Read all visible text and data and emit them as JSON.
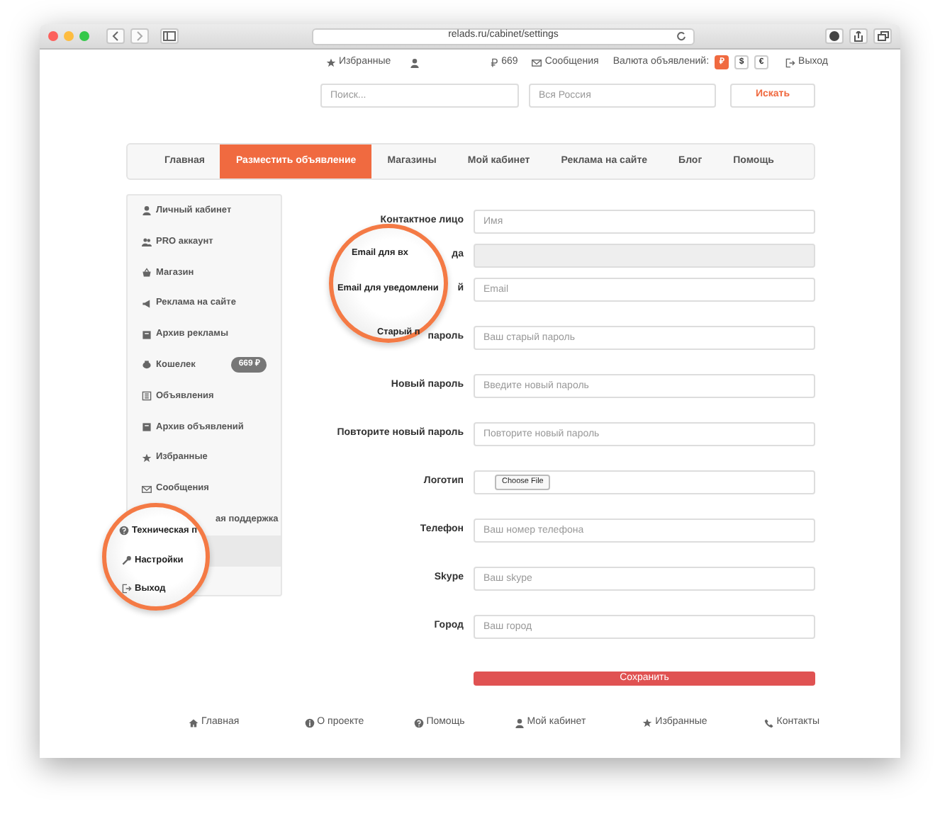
{
  "browser": {
    "url": "relads.ru/cabinet/settings"
  },
  "topbar": {
    "favorites": "Избранные",
    "balance": "669",
    "messages": "Сообщения",
    "currency_label": "Валюта объявлений:",
    "currencies": [
      {
        "label": "₽",
        "selected": true
      },
      {
        "label": "$",
        "selected": false
      },
      {
        "label": "€",
        "selected": false
      }
    ],
    "logout": "Выход"
  },
  "search": {
    "query_placeholder": "Поиск...",
    "region_placeholder": "Вся Россия",
    "button": "Искать"
  },
  "nav": [
    {
      "label": "Главная",
      "selected": false
    },
    {
      "label": "Разместить объявление",
      "selected": true
    },
    {
      "label": "Магазины",
      "selected": false
    },
    {
      "label": "Мой кабинет",
      "selected": false
    },
    {
      "label": "Реклама на сайте",
      "selected": false
    },
    {
      "label": "Блог",
      "selected": false
    },
    {
      "label": "Помощь",
      "selected": false
    }
  ],
  "sidebar": [
    {
      "label": "Личный кабинет",
      "selected": false
    },
    {
      "label": "PRO аккаунт",
      "selected": false
    },
    {
      "label": "Магазин",
      "selected": false
    },
    {
      "label": "Реклама на сайте",
      "selected": false
    },
    {
      "label": "Архив рекламы",
      "selected": false
    },
    {
      "label": "Кошелек",
      "selected": false,
      "badge": "669 ₽"
    },
    {
      "label": "Объявления",
      "selected": false
    },
    {
      "label": "Архив объявлений",
      "selected": false
    },
    {
      "label": "Избранные",
      "selected": false
    },
    {
      "label": "Сообщения",
      "selected": false
    },
    {
      "label": "ая поддержка",
      "selected": false
    },
    {
      "selected": true
    }
  ],
  "form": {
    "fields": [
      {
        "label": "Контактное лицо",
        "kind": "text",
        "placeholder": "Имя"
      },
      {
        "label": "да",
        "kind": "disabled"
      },
      {
        "label": "й",
        "kind": "text",
        "placeholder": "Email"
      },
      {
        "label": "пароль",
        "kind": "text",
        "placeholder": "Ваш старый пароль"
      },
      {
        "label": "Новый пароль",
        "kind": "text",
        "placeholder": "Введите новый пароль"
      },
      {
        "label": "Повторите новый пароль",
        "kind": "text",
        "placeholder": "Повторите новый пароль"
      },
      {
        "label": "Логотип",
        "kind": "file",
        "button": "Choose File"
      },
      {
        "label": "Телефон",
        "kind": "text",
        "placeholder": "Ваш номер телефона"
      },
      {
        "label": "Skype",
        "kind": "text",
        "placeholder": "Ваш skype"
      },
      {
        "label": "Город",
        "kind": "text",
        "placeholder": "Ваш город"
      }
    ],
    "save": "Сохранить"
  },
  "footer": [
    "Главная",
    "О проекте",
    "Помощь",
    "Мой кабинет",
    "Избранные",
    "Контакты"
  ],
  "magnifiers": [
    {
      "texts": [
        "Email для вх",
        "Email для уведомлени",
        "Старый п"
      ]
    },
    {
      "texts": [
        "Техническая п",
        "Настройки",
        "Выход"
      ]
    }
  ]
}
